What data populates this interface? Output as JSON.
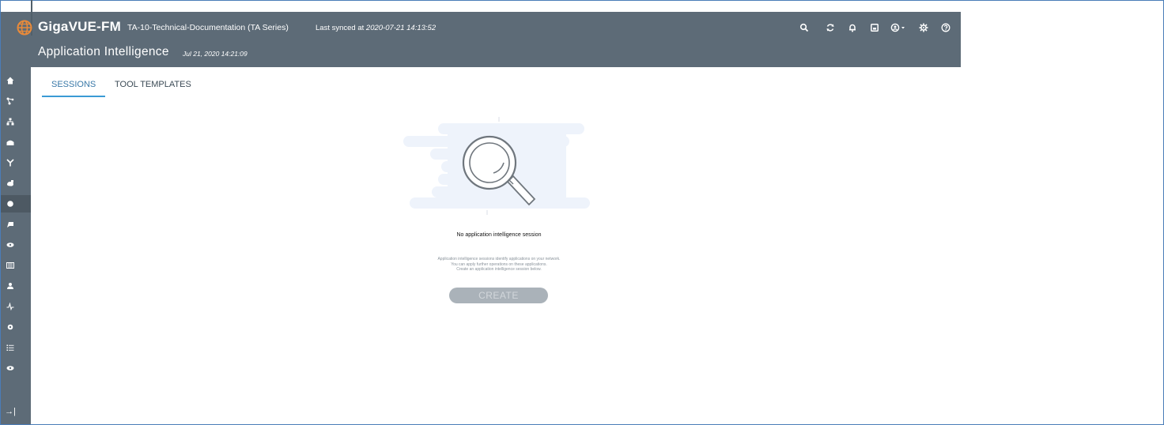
{
  "header": {
    "brand": "GigaVUE-FM",
    "project": "TA-10-Technical-Documentation (TA Series)",
    "sync_prefix": "Last synced at ",
    "sync_time": "2020-07-21 14:13:52",
    "icons": [
      "search-icon",
      "refresh-icon",
      "bell-icon",
      "save-icon",
      "user-icon",
      "settings-icon",
      "help-icon"
    ]
  },
  "page": {
    "title": "Application Intelligence",
    "date": "Jul 21, 2020 14:21:09"
  },
  "tabs": [
    {
      "label": "SESSIONS",
      "active": true
    },
    {
      "label": "TOOL TEMPLATES",
      "active": false
    }
  ],
  "sidebar": {
    "icons": [
      "home-icon",
      "topology-icon",
      "inventory-icon",
      "physical-icon",
      "traffic-icon",
      "virtual-icon",
      "application-icon",
      "ports-icon",
      "visibility-icon",
      "table-icon",
      "users-icon",
      "health-icon",
      "settings-icon",
      "list-icon",
      "monitor-icon"
    ],
    "active": "application-icon",
    "collapse": "→|"
  },
  "empty_state": {
    "title": "No application intelligence session",
    "description_lines": [
      "Application intelligence sessions identify applications on your network.",
      "You can apply further operations on these applications.",
      "Create an application intelligence session below."
    ],
    "create_label": "CREATE"
  },
  "colors": {
    "header_bg": "#5d6b77",
    "accent": "#3a9bd5",
    "button_disabled": "#aab2b9",
    "logo": "#e88a3a"
  }
}
